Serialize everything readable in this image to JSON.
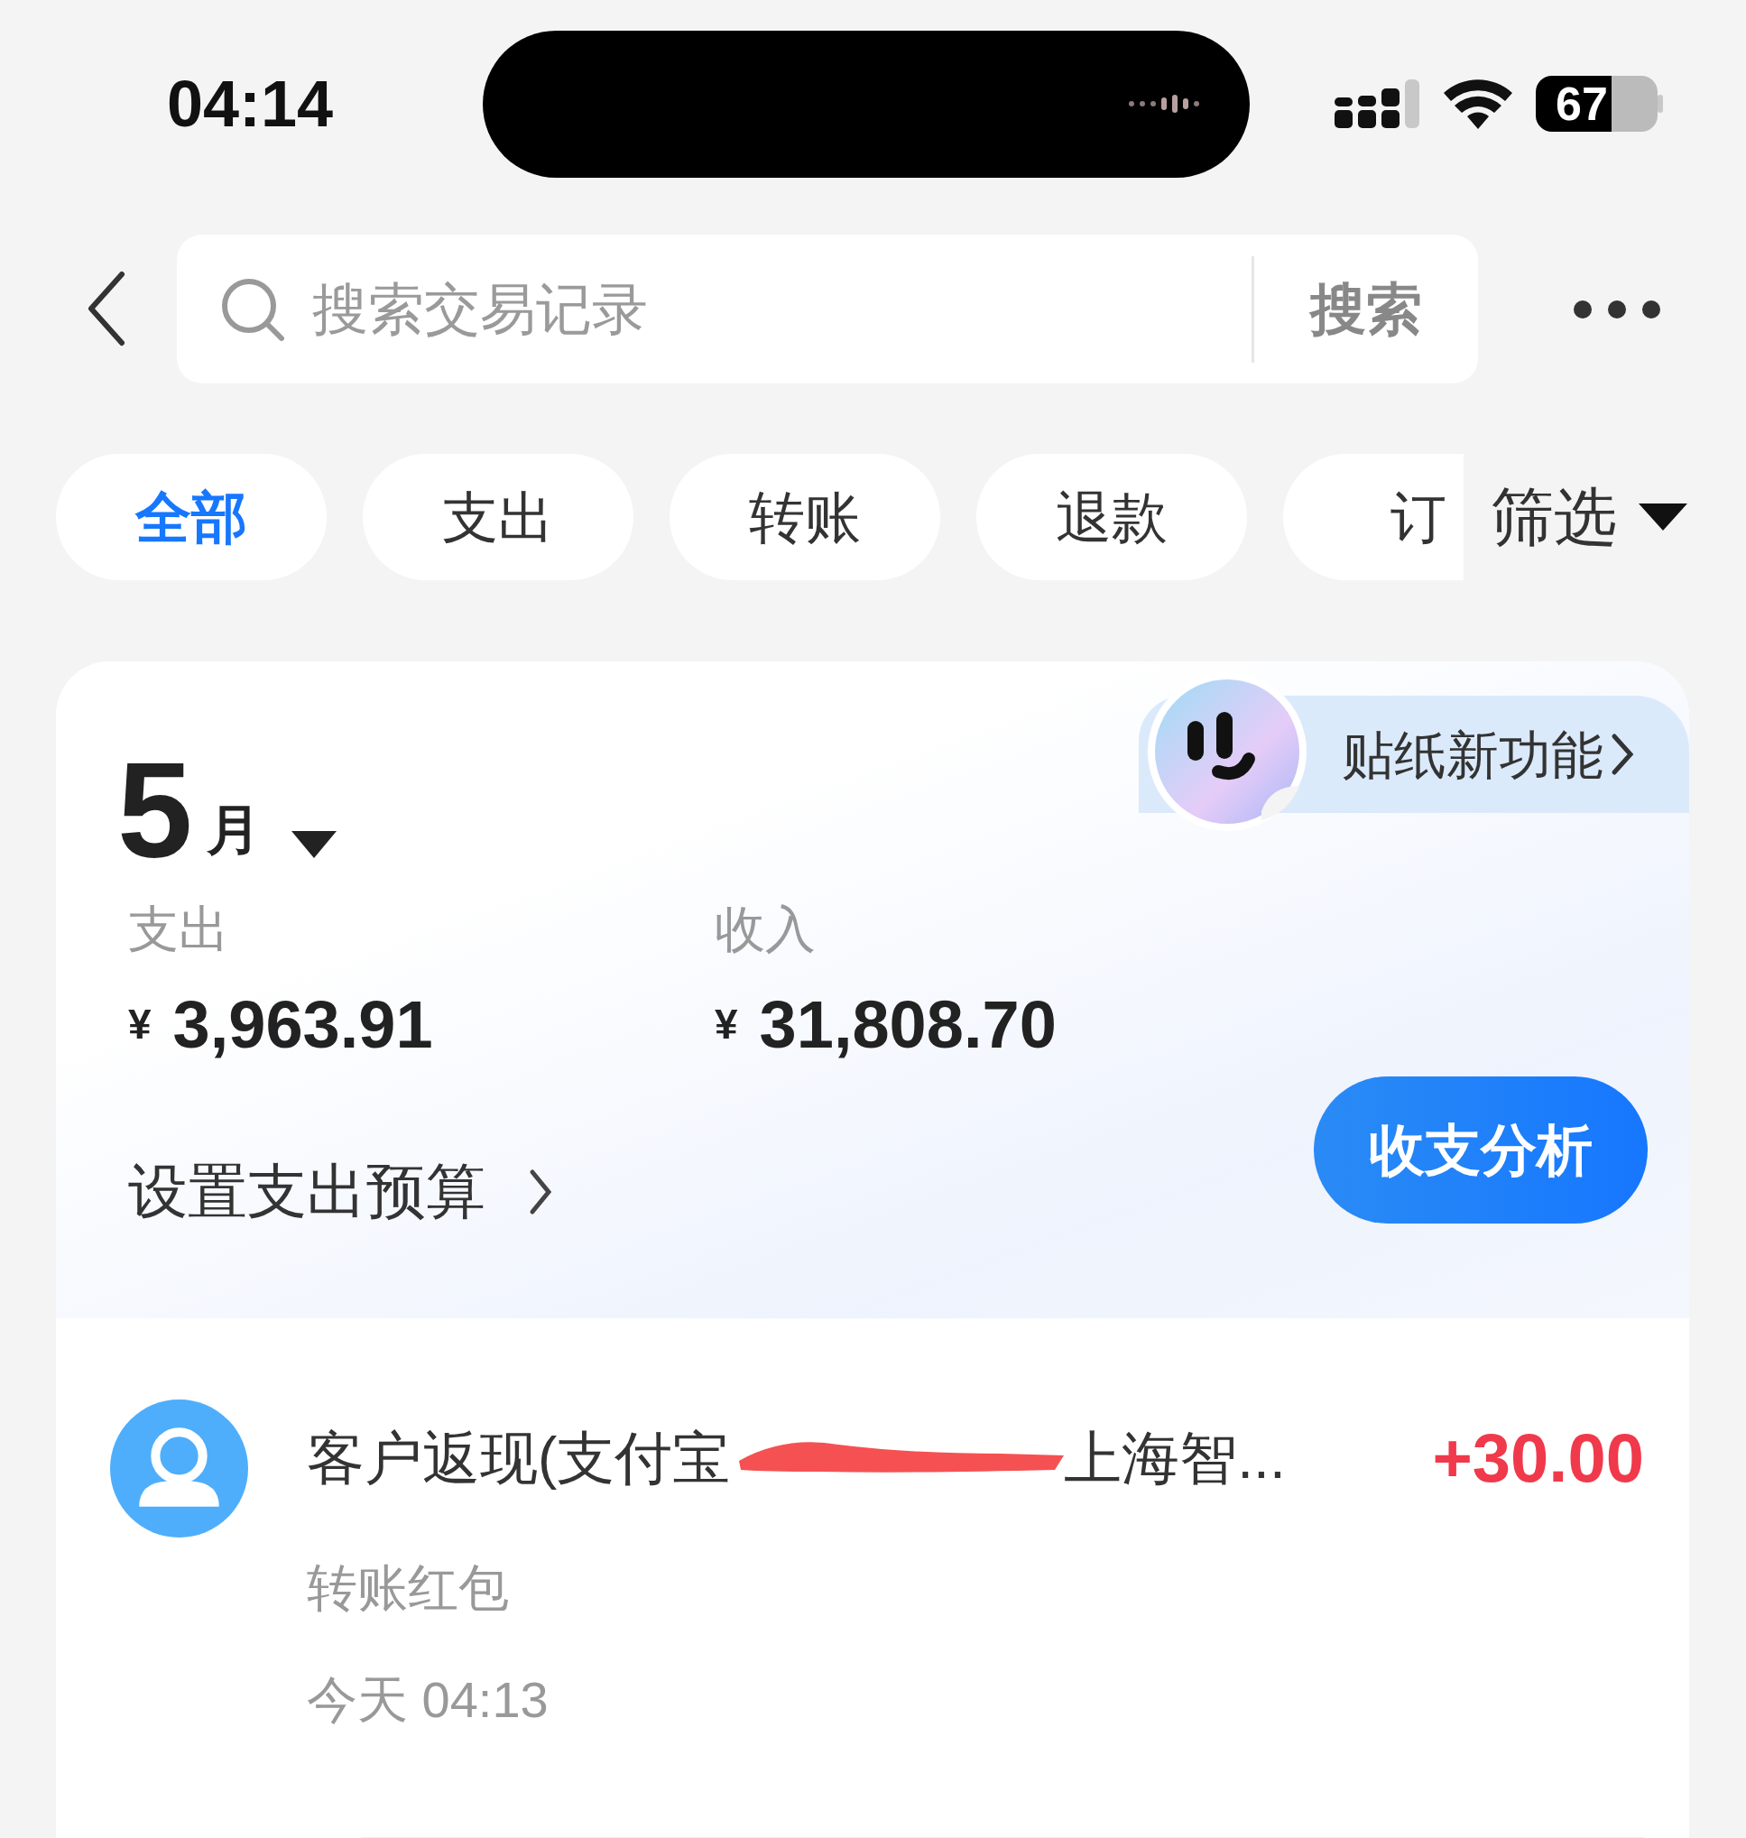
{
  "status_bar": {
    "time": "04:14",
    "battery": "67"
  },
  "search": {
    "placeholder": "搜索交易记录",
    "button": "搜索"
  },
  "filters": [
    {
      "label": "全部",
      "selected": true
    },
    {
      "label": "支出",
      "selected": false
    },
    {
      "label": "转账",
      "selected": false
    },
    {
      "label": "退款",
      "selected": false
    },
    {
      "label": "订",
      "selected": false
    }
  ],
  "filter_menu": {
    "label": "筛选"
  },
  "summary": {
    "month": "5",
    "month_unit": "月",
    "banner": "贴纸新功能",
    "stats": [
      {
        "label": "支出",
        "currency": "¥",
        "amount": "3,963.91"
      },
      {
        "label": "收入",
        "currency": "¥",
        "amount": "31,808.70"
      }
    ],
    "budget_link": "设置支出预算",
    "analysis_button": "收支分析"
  },
  "transactions": [
    {
      "title_start": "客户返现(支付宝",
      "redacted": true,
      "title_end": "上海智...",
      "amount": "+30.00",
      "category": "转账红包",
      "time": "今天 04:13"
    }
  ]
}
